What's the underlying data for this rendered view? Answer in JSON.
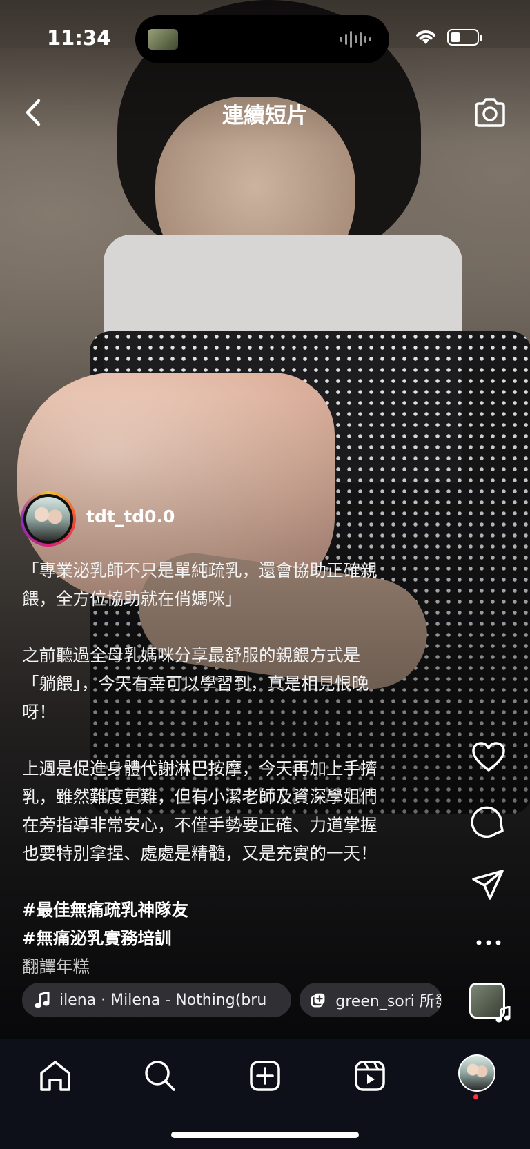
{
  "status_bar": {
    "time": "11:34",
    "battery_level": 0.4
  },
  "header": {
    "title": "連續短片",
    "back_icon": "chevron-left-icon",
    "camera_icon": "camera-icon"
  },
  "post": {
    "username": "tdt_td0.0",
    "caption": {
      "para1": "「專業泌乳師不只是單純疏乳，還會協助正確親\n餵，全方位協助就在俏媽咪」",
      "para2": "之前聽過全母乳媽咪分享最舒服的親餵方式是\n「躺餵」，今天有幸可以學習到，真是相見恨晚\n呀！",
      "para3": "上週是促進身體代謝淋巴按摩，今天再加上手擠\n乳，雖然難度更難，但有小潔老師及資深學姐們\n在旁指導非常安心，不僅手勢要正確、力道掌握\n也要特別拿捏、處處是精髓，又是充實的一天！",
      "hashtag1": "#最佳無痛疏乳神隊友",
      "hashtag2": "#無痛泌乳實務培訓",
      "translate": "翻譯年糕"
    },
    "music_label": "ilena · Milena - Nothing(bru",
    "collab_label": "green_sori 所發"
  },
  "actions": [
    "heart-icon",
    "comment-icon",
    "share-icon",
    "more-icon",
    "audio-thumbnail"
  ],
  "nav": [
    "home-icon",
    "search-icon",
    "create-icon",
    "reels-icon",
    "profile-avatar"
  ],
  "colors": {
    "background": "#0d1018",
    "notification_dot": "#ff3040",
    "story_ring": [
      "#f6c133",
      "#f04e2f",
      "#d6237a",
      "#8f2bc7"
    ]
  }
}
